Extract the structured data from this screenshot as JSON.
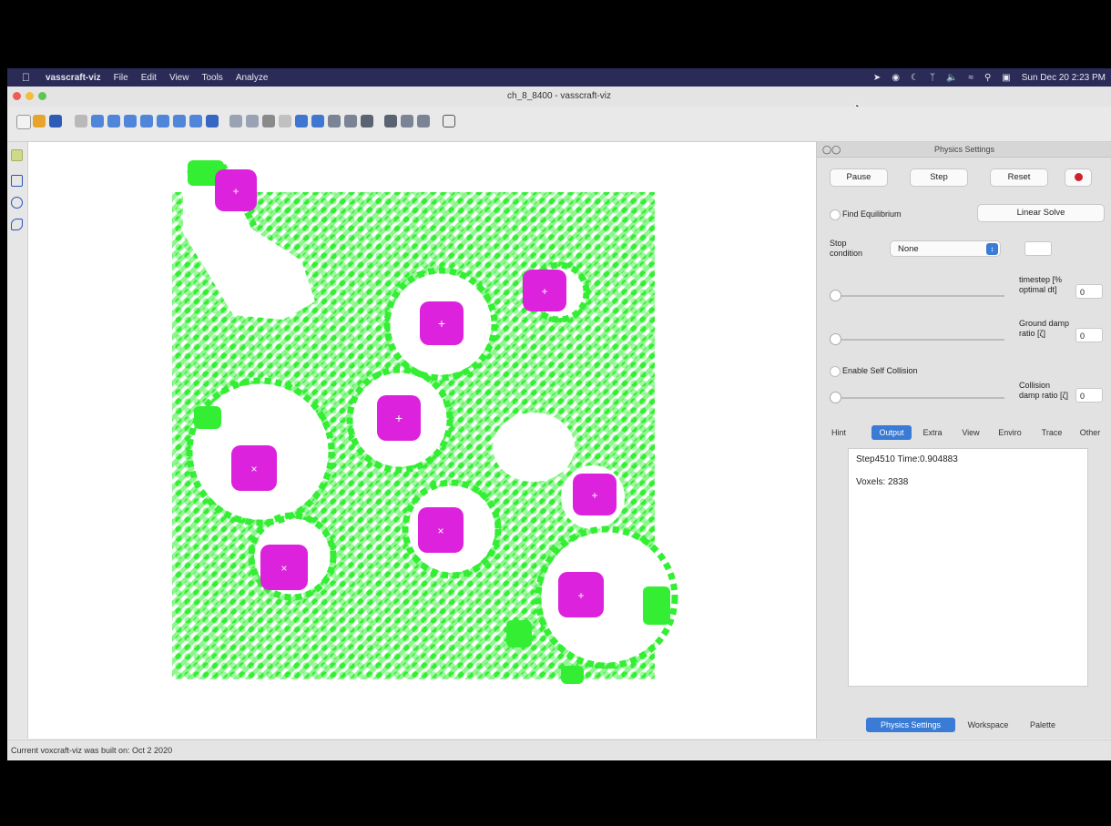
{
  "menubar": {
    "apple_icon": "apple-icon",
    "app_name": "vasscraft-viz",
    "items": [
      "File",
      "Edit",
      "View",
      "Tools",
      "Analyze"
    ],
    "clock": "Sun Dec 20 2:23 PM"
  },
  "window": {
    "title": "ch_8_8400 - vasscraft-viz"
  },
  "panel": {
    "title": "Physics Settings",
    "pause_label": "Pause",
    "step_label": "Step",
    "reset_label": "Reset",
    "find_equilibrium_label": "Find Equilibrium",
    "linear_solve_label": "Linear Solve",
    "stop_condition_label": "Stop condition",
    "stop_condition_value": "None",
    "timestep_label": "timestep [% optimal dt]",
    "timestep_value": "0",
    "ground_damp_label": "Ground damp ratio [ζ]",
    "ground_damp_value": "0",
    "self_collision_label": "Enable Self Collision",
    "collision_damp_label": "Collision damp ratio [ζ]",
    "collision_damp_value": "0",
    "tabs": [
      "Hint",
      "Output",
      "Extra",
      "View",
      "Enviro",
      "Trace",
      "Other"
    ],
    "active_tab": "Output",
    "output_lines": [
      "Step4510 Time:0.904883",
      "Voxels: 2838"
    ],
    "bottom_tabs": [
      "Physics Settings",
      "Workspace",
      "Palette"
    ]
  },
  "statusbar": {
    "text": "Current voxcraft-viz was built on: Oct 2 2020"
  },
  "colors": {
    "menubar": "#2a2b57",
    "voxel_green": "#33ee33",
    "actuator_magenta": "#dd22dd",
    "tab_active": "#3a7bd5",
    "stop_button_red": "#d21f2f"
  }
}
